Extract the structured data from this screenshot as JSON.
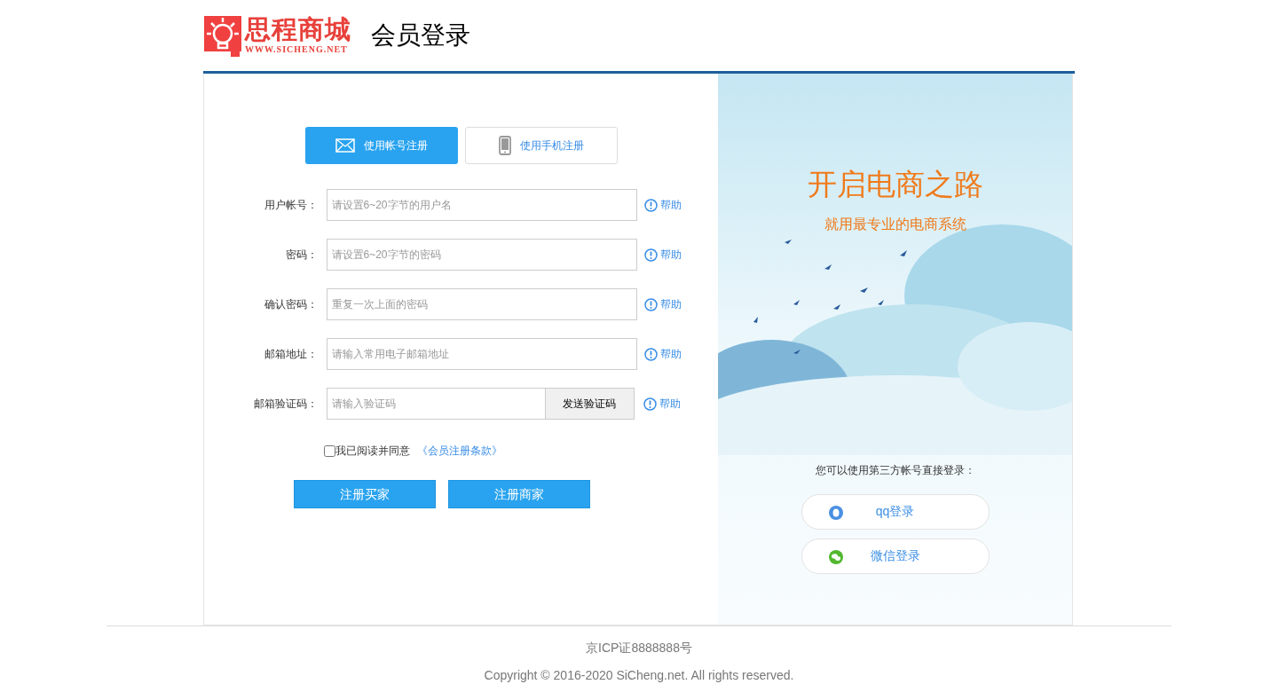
{
  "header": {
    "logo_name": "思程商城",
    "logo_url": "WWW.SICHENG.NET",
    "title": "会员登录"
  },
  "tabs": [
    {
      "label": "使用帐号注册",
      "kind": "mail",
      "selected": true
    },
    {
      "label": "使用手机注册",
      "kind": "phone",
      "selected": false
    }
  ],
  "form": {
    "fields": [
      {
        "kind": "text",
        "label": "用户帐号：",
        "placeholder": "请设置6~20字节的用户名",
        "help": "帮助"
      },
      {
        "kind": "text",
        "label": "密码：",
        "placeholder": "请设置6~20字节的密码",
        "help": "帮助"
      },
      {
        "kind": "text",
        "label": "确认密码：",
        "placeholder": "重复一次上面的密码",
        "help": "帮助"
      },
      {
        "kind": "text",
        "label": "邮箱地址：",
        "placeholder": "请输入常用电子邮箱地址",
        "help": "帮助"
      },
      {
        "kind": "code",
        "label": "邮箱验证码：",
        "placeholder": "请输入验证码",
        "button": "发送验证码",
        "help": "帮助"
      }
    ],
    "agreement": {
      "checked": false,
      "text": "我已阅读并同意",
      "link": "《会员注册条款》"
    },
    "buttons": [
      "注册买家",
      "注册商家"
    ]
  },
  "promo": {
    "title": "开启电商之路",
    "subtitle": "就用最专业的电商系统",
    "third_party_prompt": "您可以使用第三方帐号直接登录：",
    "logins": [
      {
        "kind": "qq",
        "label": "qq登录"
      },
      {
        "kind": "wechat",
        "label": "微信登录"
      }
    ]
  },
  "footer": {
    "icp": "京ICP证8888888号",
    "copyright": "Copyright © 2016-2020 SiCheng.net. All rights reserved."
  }
}
